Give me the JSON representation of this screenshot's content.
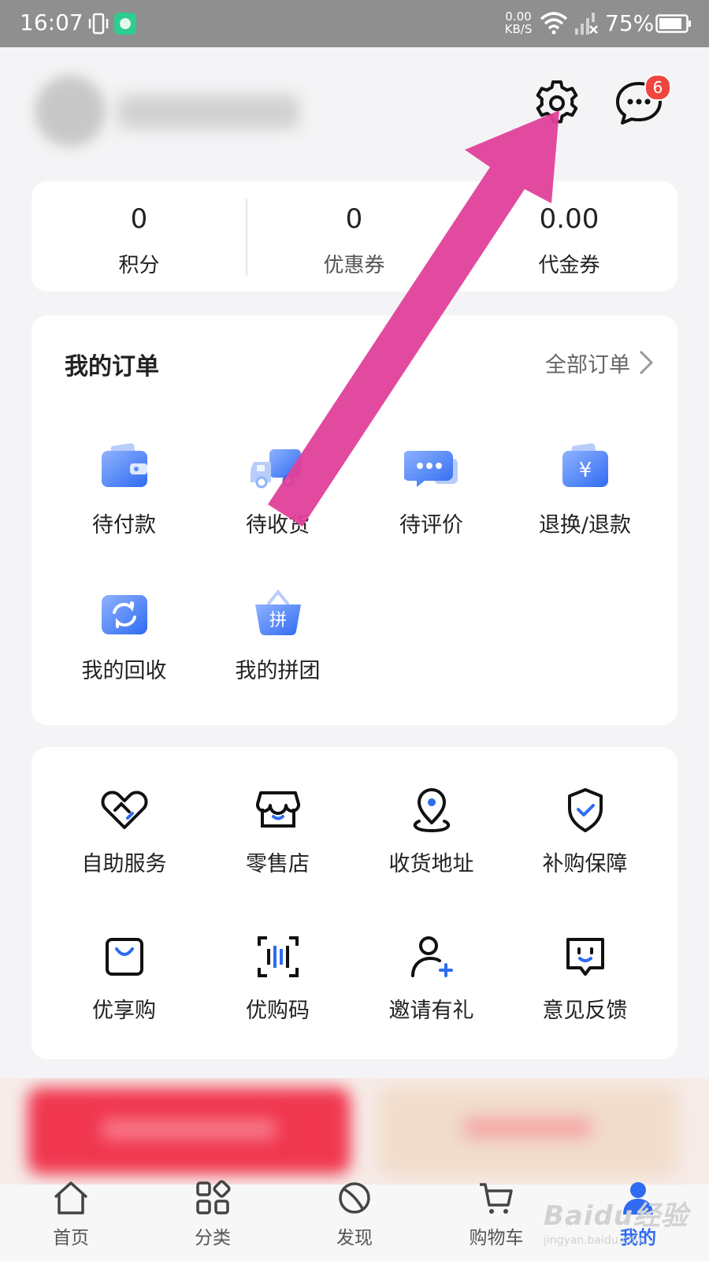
{
  "status_bar": {
    "time": "16:07",
    "net_speed_value": "0.00",
    "net_speed_unit": "KB/S",
    "battery": "75%"
  },
  "header": {
    "settings_icon": "gear-icon",
    "messages_icon": "chat-bubble-icon",
    "message_badge": "6"
  },
  "stats": [
    {
      "value": "0",
      "label": "积分"
    },
    {
      "value": "0",
      "label": "优惠券"
    },
    {
      "value": "0.00",
      "label": "代金券"
    }
  ],
  "orders": {
    "title": "我的订单",
    "all_label": "全部订单",
    "items": [
      {
        "label": "待付款",
        "icon": "wallet-icon"
      },
      {
        "label": "待收货",
        "icon": "truck-icon"
      },
      {
        "label": "待评价",
        "icon": "comment-icon"
      },
      {
        "label": "退换/退款",
        "icon": "refund-icon"
      },
      {
        "label": "我的回收",
        "icon": "recycle-icon"
      },
      {
        "label": "我的拼团",
        "icon": "group-buy-basket-icon",
        "glyph": "拼"
      }
    ]
  },
  "services": [
    {
      "label": "自助服务",
      "icon": "heart-handshake-icon"
    },
    {
      "label": "零售店",
      "icon": "store-icon"
    },
    {
      "label": "收货地址",
      "icon": "location-pin-icon"
    },
    {
      "label": "补购保障",
      "icon": "shield-check-icon"
    },
    {
      "label": "优享购",
      "icon": "shopping-bag-icon"
    },
    {
      "label": "优购码",
      "icon": "barcode-icon"
    },
    {
      "label": "邀请有礼",
      "icon": "add-user-icon"
    },
    {
      "label": "意见反馈",
      "icon": "feedback-icon"
    }
  ],
  "tabs": [
    {
      "label": "首页",
      "icon": "home-icon"
    },
    {
      "label": "分类",
      "icon": "category-icon"
    },
    {
      "label": "发现",
      "icon": "discover-icon"
    },
    {
      "label": "购物车",
      "icon": "cart-icon"
    },
    {
      "label": "我的",
      "icon": "user-icon",
      "active": true
    }
  ],
  "watermark": {
    "logo": "Baidu经验",
    "url": "jingyan.baidu.com"
  },
  "colors": {
    "accent": "#2f6bf1",
    "annotation_arrow": "#e0409b",
    "badge": "#f0453f",
    "status_bar": "#8f8f8f"
  }
}
